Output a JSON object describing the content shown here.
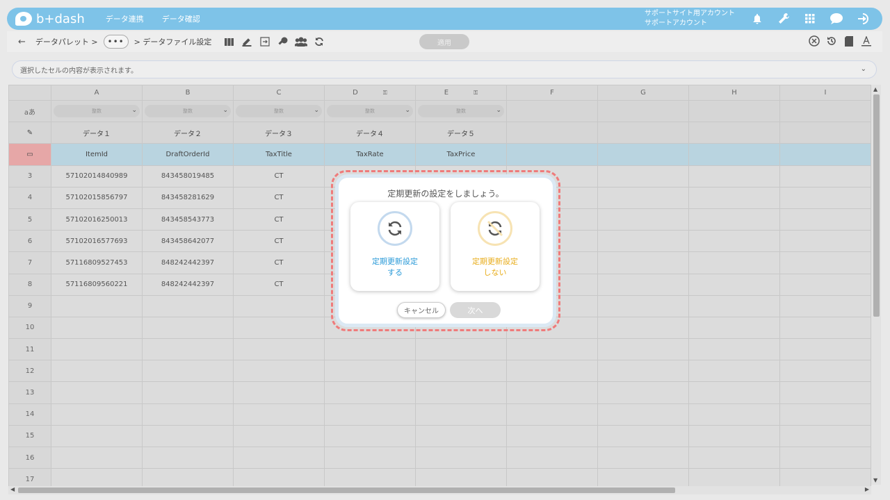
{
  "header": {
    "logo": "b+dash",
    "nav": [
      "データ連携",
      "データ確認"
    ],
    "account_line1": "サポートサイト用アカウント",
    "account_line2": "サポートアカウント",
    "icons": [
      "bell-icon",
      "wrench-icon",
      "grid-apps-icon",
      "chat-icon",
      "logout-icon"
    ]
  },
  "toolbar": {
    "back": "←",
    "crumb1": "データパレット >",
    "more": "•••",
    "crumb2": "> データファイル設定",
    "apply": "適用",
    "icons": [
      "columns-icon",
      "edit-icon",
      "export-icon",
      "key-icon",
      "users-icon",
      "refresh-icon"
    ],
    "right_icons": [
      "close-circle-icon",
      "history-icon",
      "file-icon",
      "text-format-icon"
    ]
  },
  "formula_bar": {
    "placeholder": "選択したセルの内容が表示されます。",
    "chevron": "⌄"
  },
  "grid": {
    "columns": [
      "A",
      "B",
      "C",
      "D",
      "E",
      "F",
      "G",
      "H",
      "I"
    ],
    "type_row_label": "aあ",
    "select_placeholder": "整数",
    "edit_row_icon": "edit-icon",
    "key_row_icon": "calendar-icon",
    "labels": [
      "データ１",
      "データ２",
      "データ３",
      "データ４",
      "データ５"
    ],
    "keys": [
      "ItemId",
      "DraftOrderId",
      "TaxTitle",
      "TaxRate",
      "TaxPrice"
    ],
    "rows": [
      {
        "num": "3",
        "a": "57102014840989",
        "b": "843458019485",
        "c": "CT"
      },
      {
        "num": "4",
        "a": "57102015856797",
        "b": "843458281629",
        "c": "CT"
      },
      {
        "num": "5",
        "a": "57102016250013",
        "b": "843458543773",
        "c": "CT"
      },
      {
        "num": "6",
        "a": "57102016577693",
        "b": "843458642077",
        "c": "CT"
      },
      {
        "num": "7",
        "a": "57116809527453",
        "b": "848242442397",
        "c": "CT"
      },
      {
        "num": "8",
        "a": "57116809560221",
        "b": "848242442397",
        "c": "CT"
      },
      {
        "num": "9",
        "a": "",
        "b": "",
        "c": ""
      },
      {
        "num": "10",
        "a": "",
        "b": "",
        "c": ""
      },
      {
        "num": "11",
        "a": "",
        "b": "",
        "c": ""
      },
      {
        "num": "12",
        "a": "",
        "b": "",
        "c": ""
      },
      {
        "num": "13",
        "a": "",
        "b": "",
        "c": ""
      },
      {
        "num": "14",
        "a": "",
        "b": "",
        "c": ""
      },
      {
        "num": "15",
        "a": "",
        "b": "",
        "c": ""
      },
      {
        "num": "16",
        "a": "",
        "b": "",
        "c": ""
      },
      {
        "num": "17",
        "a": "",
        "b": "",
        "c": ""
      }
    ]
  },
  "modal": {
    "title": "定期更新の設定をしましょう。",
    "option_yes_line1": "定期更新設定",
    "option_yes_line2": "する",
    "option_no_line1": "定期更新設定",
    "option_no_line2": "しない",
    "cancel": "キャンセル",
    "next": "次へ",
    "colors": {
      "yes": "#2a9ad8",
      "no": "#e8ad1c",
      "outline": "#ef7b7b"
    }
  }
}
